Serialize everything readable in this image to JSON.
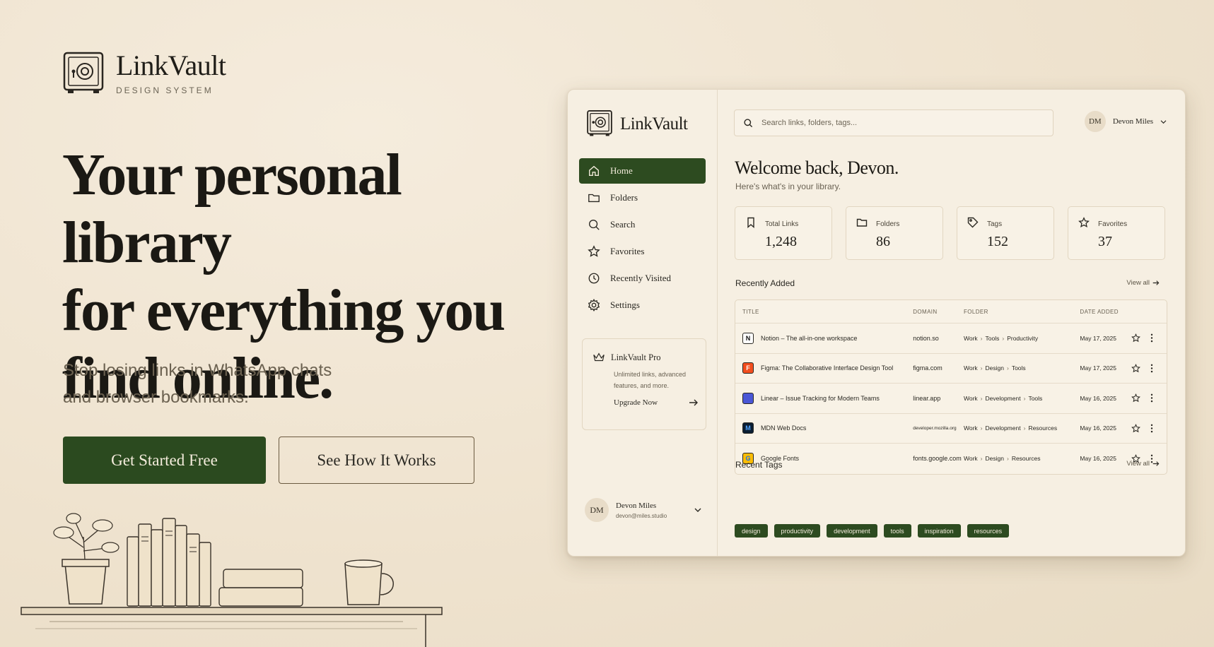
{
  "brand": {
    "name": "LinkVault",
    "tagline": "DESIGN SYSTEM"
  },
  "hero": {
    "title_line1": "Your personal library",
    "title_line2": "for everything you",
    "title_line3": "find online.",
    "subtitle_line1": "Stop losing links in WhatsApp chats",
    "subtitle_line2": "and browser bookmarks.",
    "primary_cta": "Get Started Free",
    "secondary_cta": "See How It Works"
  },
  "app": {
    "logo": "LinkVault",
    "search_placeholder": "Search links, folders, tags...",
    "top_user": {
      "initials": "DM",
      "name": "Devon Miles"
    },
    "nav": [
      {
        "label": "Home",
        "icon": "home-icon",
        "active": true
      },
      {
        "label": "Folders",
        "icon": "folder-icon"
      },
      {
        "label": "Search",
        "icon": "search-icon"
      },
      {
        "label": "Favorites",
        "icon": "star-icon"
      },
      {
        "label": "Recently Visited",
        "icon": "clock-icon"
      },
      {
        "label": "Settings",
        "icon": "gear-icon"
      }
    ],
    "pro": {
      "title": "LinkVault Pro",
      "desc": "Unlimited links, advanced features, and more.",
      "cta": "Upgrade Now"
    },
    "user": {
      "initials": "DM",
      "name": "Devon Miles",
      "email": "devon@miles.studio"
    },
    "welcome": "Welcome back, Devon.",
    "welcome_sub": "Here's what's in your library.",
    "stats": [
      {
        "label": "Total Links",
        "value": "1,248",
        "icon": "bookmark-icon"
      },
      {
        "label": "Folders",
        "value": "86",
        "icon": "folder-icon"
      },
      {
        "label": "Tags",
        "value": "152",
        "icon": "tag-icon"
      },
      {
        "label": "Favorites",
        "value": "37",
        "icon": "star-icon"
      }
    ],
    "recent": {
      "title": "Recently Added",
      "view_all": "View all",
      "columns": [
        "TITLE",
        "DOMAIN",
        "FOLDER",
        "DATE ADDED"
      ],
      "rows": [
        {
          "title": "Notion – The all-in-one workspace",
          "domain": "notion.so",
          "folder": [
            "Work",
            "Tools",
            "Productivity"
          ],
          "date": "May 17, 2025",
          "favicon": "N",
          "favicon_bg": "#ffffff",
          "favicon_fg": "#111111"
        },
        {
          "title": "Figma: The Collaborative Interface Design Tool",
          "domain": "figma.com",
          "folder": [
            "Work",
            "Design",
            "Tools"
          ],
          "date": "May 17, 2025",
          "favicon": "F",
          "favicon_bg": "#f24e1e",
          "favicon_fg": "#ffffff"
        },
        {
          "title": "Linear – Issue Tracking for Modern Teams",
          "domain": "linear.app",
          "folder": [
            "Work",
            "Development",
            "Tools"
          ],
          "date": "May 16, 2025",
          "favicon": "",
          "favicon_bg": "#4a57d6",
          "favicon_fg": "#ffffff"
        },
        {
          "title": "MDN Web Docs",
          "domain": "developer.mozilla.org",
          "folder": [
            "Work",
            "Development",
            "Resources"
          ],
          "date": "May 16, 2025",
          "favicon": "M",
          "favicon_bg": "#0b1e33",
          "favicon_fg": "#4fa3ff"
        },
        {
          "title": "Google Fonts",
          "domain": "fonts.google.com",
          "folder": [
            "Work",
            "Design",
            "Resources"
          ],
          "date": "May 16, 2025",
          "favicon": "G",
          "favicon_bg": "#fbbc05",
          "favicon_fg": "#1a73e8"
        }
      ]
    },
    "tags": {
      "title": "Recent Tags",
      "view_all": "View all",
      "items": [
        "design",
        "productivity",
        "development",
        "tools",
        "inspiration",
        "resources"
      ]
    }
  },
  "colors": {
    "accent": "#2d4b20",
    "paper": "#f1e7d6",
    "ink": "#1f1d18"
  }
}
